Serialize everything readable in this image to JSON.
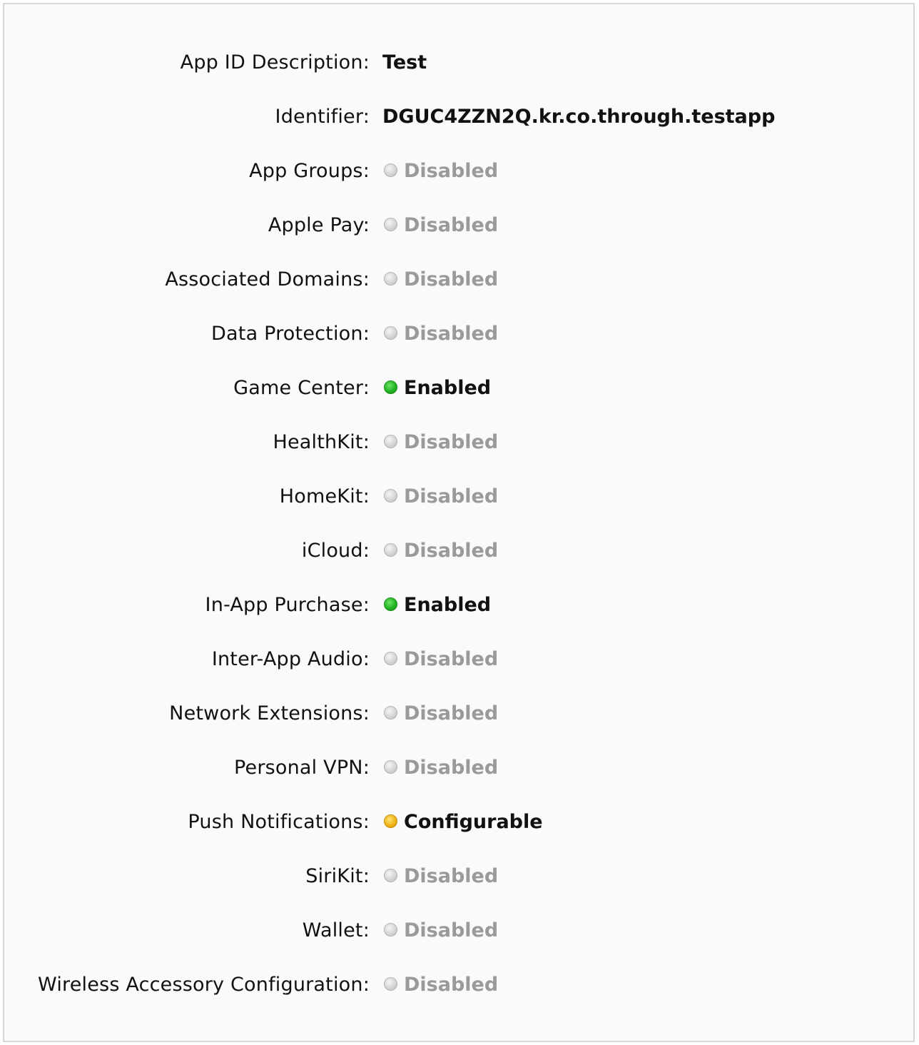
{
  "app_id": {
    "description_label": "App ID Description:",
    "description_value": "Test",
    "identifier_label": "Identifier:",
    "identifier_value": "DGUC4ZZN2Q.kr.co.through.testapp"
  },
  "services": [
    {
      "label": "App Groups:",
      "status": "Disabled",
      "state": "disabled",
      "dot_icon": "gray-status-dot-icon"
    },
    {
      "label": "Apple Pay:",
      "status": "Disabled",
      "state": "disabled",
      "dot_icon": "gray-status-dot-icon"
    },
    {
      "label": "Associated Domains:",
      "status": "Disabled",
      "state": "disabled",
      "dot_icon": "gray-status-dot-icon"
    },
    {
      "label": "Data Protection:",
      "status": "Disabled",
      "state": "disabled",
      "dot_icon": "gray-status-dot-icon"
    },
    {
      "label": "Game Center:",
      "status": "Enabled",
      "state": "enabled",
      "dot_icon": "green-status-dot-icon"
    },
    {
      "label": "HealthKit:",
      "status": "Disabled",
      "state": "disabled",
      "dot_icon": "gray-status-dot-icon"
    },
    {
      "label": "HomeKit:",
      "status": "Disabled",
      "state": "disabled",
      "dot_icon": "gray-status-dot-icon"
    },
    {
      "label": "iCloud:",
      "status": "Disabled",
      "state": "disabled",
      "dot_icon": "gray-status-dot-icon"
    },
    {
      "label": "In-App Purchase:",
      "status": "Enabled",
      "state": "enabled",
      "dot_icon": "green-status-dot-icon"
    },
    {
      "label": "Inter-App Audio:",
      "status": "Disabled",
      "state": "disabled",
      "dot_icon": "gray-status-dot-icon"
    },
    {
      "label": "Network Extensions:",
      "status": "Disabled",
      "state": "disabled",
      "dot_icon": "gray-status-dot-icon"
    },
    {
      "label": "Personal VPN:",
      "status": "Disabled",
      "state": "disabled",
      "dot_icon": "gray-status-dot-icon"
    },
    {
      "label": "Push Notifications:",
      "status": "Configurable",
      "state": "configurable",
      "dot_icon": "yellow-status-dot-icon"
    },
    {
      "label": "SiriKit:",
      "status": "Disabled",
      "state": "disabled",
      "dot_icon": "gray-status-dot-icon"
    },
    {
      "label": "Wallet:",
      "status": "Disabled",
      "state": "disabled",
      "dot_icon": "gray-status-dot-icon"
    },
    {
      "label": "Wireless Accessory Configuration:",
      "status": "Disabled",
      "state": "disabled",
      "dot_icon": "gray-status-dot-icon"
    }
  ],
  "colors": {
    "background": "#f9faf9",
    "border": "#d7d7d7",
    "text": "#111111",
    "disabled_text": "#9a9a9a",
    "enabled_dot": "#22b322",
    "configurable_dot": "#f0b418",
    "disabled_dot": "#d6d6d6"
  }
}
